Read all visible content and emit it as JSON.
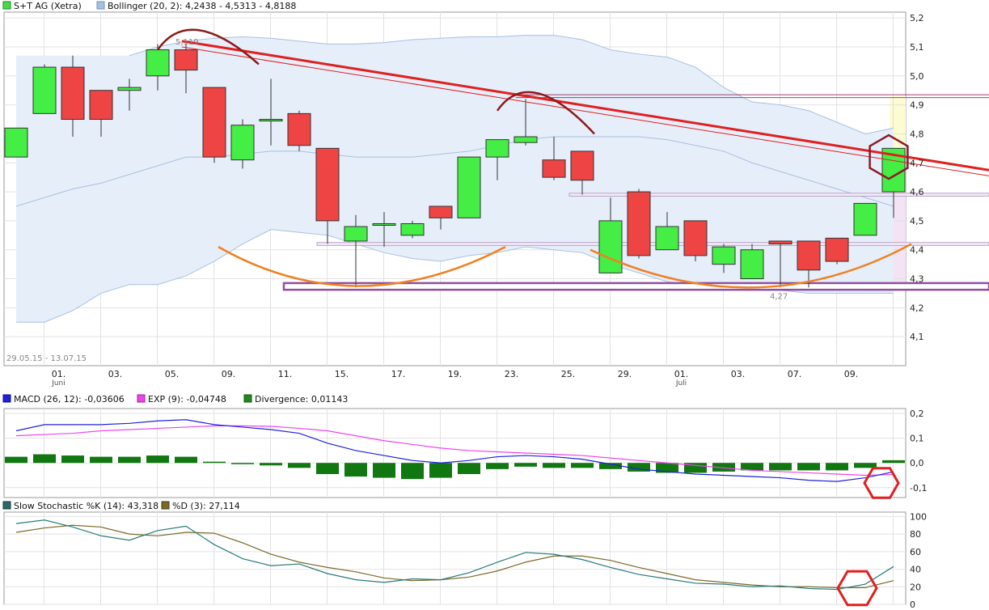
{
  "legends": {
    "main": [
      {
        "label": "S+T AG (Xetra)",
        "color": "#44dd44",
        "border": "#228822"
      },
      {
        "label": "Bollinger (20, 2): 4,2438 - 4,5313 - 4,8188",
        "color": "#a8c0e0",
        "border": "#7090c0"
      }
    ],
    "macd": [
      {
        "label": "MACD (26, 12): -0,03606",
        "color": "#2020dd",
        "border": "#101080"
      },
      {
        "label": "EXP (9): -0,04748",
        "color": "#ee44ee",
        "border": "#992299"
      },
      {
        "label": "Divergence: 0,01143",
        "color": "#228822",
        "border": "#115511"
      }
    ],
    "stoch": [
      {
        "label": "Slow Stochastic %K (14): 43,318",
        "color": "#2a6a6a",
        "border": "#143a3a"
      },
      {
        "label": "%D (3): 27,114",
        "color": "#7a6a2a",
        "border": "#4a3a10"
      }
    ]
  },
  "date_range_label": "29.05.15 - 13.07.15",
  "annotations": {
    "high": "5,119",
    "low": "4,27"
  },
  "colors": {
    "up": "#44ee44",
    "down": "#ee4444",
    "band": "#e6eefa",
    "band_line": "#a8c0e0",
    "trend": "#e02020",
    "resistance": "#a04070",
    "support": "#9050a0",
    "arc_top": "#8b1a1a",
    "arc_bottom": "#f08020",
    "marker": "#8b1a2a",
    "marker_red": "#e02020",
    "macd": "#2020dd",
    "exp": "#ee44ee",
    "divergence": "#117711",
    "stoch_k": "#2a7a7a",
    "stoch_d": "#7a6a2a",
    "zone_yellow": "#fdfbd2",
    "zone_pink": "#f3e3f5"
  },
  "chart_data": [
    {
      "type": "candlestick",
      "title": "S+T AG (Xetra)",
      "ylim": [
        4.0,
        5.22
      ],
      "yticks": [
        "5,2",
        "5,1",
        "5,0",
        "4,9",
        "4,8",
        "4,7",
        "4,6",
        "4,5",
        "4,4",
        "4,3",
        "4,2",
        "4,1"
      ],
      "ytick_values": [
        5.2,
        5.1,
        5.0,
        4.9,
        4.8,
        4.7,
        4.6,
        4.5,
        4.4,
        4.3,
        4.2,
        4.1
      ],
      "xticks": [
        {
          "label": "01.",
          "i": 1,
          "sub": "Juni"
        },
        {
          "label": "03.",
          "i": 3
        },
        {
          "label": "05.",
          "i": 5
        },
        {
          "label": "09.",
          "i": 7
        },
        {
          "label": "11.",
          "i": 9
        },
        {
          "label": "15.",
          "i": 11
        },
        {
          "label": "17.",
          "i": 13
        },
        {
          "label": "19.",
          "i": 15
        },
        {
          "label": "23.",
          "i": 17
        },
        {
          "label": "25.",
          "i": 19
        },
        {
          "label": "29.",
          "i": 21
        },
        {
          "label": "01.",
          "i": 23,
          "sub": "Juli"
        },
        {
          "label": "03.",
          "i": 25
        },
        {
          "label": "07.",
          "i": 27
        },
        {
          "label": "09.",
          "i": 29
        }
      ],
      "candles": [
        {
          "o": 4.72,
          "h": 4.72,
          "l": 4.72,
          "c": 4.82
        },
        {
          "o": 4.87,
          "h": 5.04,
          "l": 4.87,
          "c": 5.03
        },
        {
          "o": 5.03,
          "h": 5.07,
          "l": 4.79,
          "c": 4.85
        },
        {
          "o": 4.95,
          "h": 4.95,
          "l": 4.79,
          "c": 4.85
        },
        {
          "o": 4.95,
          "h": 4.99,
          "l": 4.88,
          "c": 4.96
        },
        {
          "o": 5.0,
          "h": 5.11,
          "l": 4.95,
          "c": 5.09
        },
        {
          "o": 5.09,
          "h": 5.12,
          "l": 4.94,
          "c": 5.02
        },
        {
          "o": 4.96,
          "h": 4.96,
          "l": 4.7,
          "c": 4.72
        },
        {
          "o": 4.71,
          "h": 4.85,
          "l": 4.68,
          "c": 4.83
        },
        {
          "o": 4.85,
          "h": 4.99,
          "l": 4.76,
          "c": 4.85
        },
        {
          "o": 4.87,
          "h": 4.88,
          "l": 4.74,
          "c": 4.76
        },
        {
          "o": 4.75,
          "h": 4.75,
          "l": 4.42,
          "c": 4.5
        },
        {
          "o": 4.43,
          "h": 4.52,
          "l": 4.27,
          "c": 4.48
        },
        {
          "o": 4.49,
          "h": 4.53,
          "l": 4.41,
          "c": 4.49
        },
        {
          "o": 4.45,
          "h": 4.5,
          "l": 4.44,
          "c": 4.49
        },
        {
          "o": 4.55,
          "h": 4.55,
          "l": 4.47,
          "c": 4.51
        },
        {
          "o": 4.51,
          "h": 4.72,
          "l": 4.51,
          "c": 4.72
        },
        {
          "o": 4.72,
          "h": 4.78,
          "l": 4.64,
          "c": 4.78
        },
        {
          "o": 4.77,
          "h": 4.92,
          "l": 4.76,
          "c": 4.79
        },
        {
          "o": 4.71,
          "h": 4.79,
          "l": 4.64,
          "c": 4.65
        },
        {
          "o": 4.74,
          "h": 4.74,
          "l": 4.59,
          "c": 4.64
        },
        {
          "o": 4.32,
          "h": 4.58,
          "l": 4.32,
          "c": 4.5
        },
        {
          "o": 4.6,
          "h": 4.61,
          "l": 4.37,
          "c": 4.38
        },
        {
          "o": 4.4,
          "h": 4.53,
          "l": 4.4,
          "c": 4.48
        },
        {
          "o": 4.5,
          "h": 4.5,
          "l": 4.36,
          "c": 4.38
        },
        {
          "o": 4.35,
          "h": 4.42,
          "l": 4.32,
          "c": 4.41
        },
        {
          "o": 4.3,
          "h": 4.42,
          "l": 4.3,
          "c": 4.4
        },
        {
          "o": 4.43,
          "h": 4.43,
          "l": 4.27,
          "c": 4.42
        },
        {
          "o": 4.43,
          "h": 4.43,
          "l": 4.27,
          "c": 4.33
        },
        {
          "o": 4.44,
          "h": 4.44,
          "l": 4.35,
          "c": 4.36
        },
        {
          "o": 4.45,
          "h": 4.56,
          "l": 4.45,
          "c": 4.56
        },
        {
          "o": 4.6,
          "h": 4.75,
          "l": 4.51,
          "c": 4.75
        }
      ],
      "bollinger_upper": [
        null,
        null,
        null,
        null,
        5.07,
        5.1,
        5.12,
        5.13,
        5.135,
        5.13,
        5.12,
        5.11,
        5.11,
        5.115,
        5.125,
        5.13,
        5.135,
        5.135,
        5.14,
        5.14,
        5.125,
        5.09,
        5.075,
        5.065,
        5.03,
        4.96,
        4.91,
        4.9,
        4.88,
        4.84,
        4.8,
        4.82
      ],
      "bollinger_mid": [
        4.55,
        4.58,
        4.61,
        4.63,
        4.66,
        4.69,
        4.72,
        4.72,
        4.73,
        4.74,
        4.74,
        4.73,
        4.72,
        4.72,
        4.72,
        4.73,
        4.74,
        4.76,
        4.78,
        4.79,
        4.79,
        4.79,
        4.79,
        4.78,
        4.76,
        4.74,
        4.7,
        4.67,
        4.64,
        4.61,
        4.58,
        4.55
      ],
      "bollinger_lower": [
        4.15,
        4.15,
        4.19,
        4.25,
        4.28,
        4.28,
        4.31,
        4.36,
        4.42,
        4.47,
        4.46,
        4.45,
        4.42,
        4.39,
        4.37,
        4.36,
        4.38,
        4.39,
        4.41,
        4.4,
        4.39,
        4.35,
        4.32,
        4.29,
        4.27,
        4.26,
        4.26,
        4.26,
        4.25,
        4.25,
        4.25,
        4.25
      ]
    },
    {
      "type": "line",
      "title": "MACD (26, 12)",
      "ylim": [
        -0.14,
        0.22
      ],
      "yticks": [
        "0,2",
        "0,1",
        "0,0",
        "-0,1"
      ],
      "ytick_values": [
        0.2,
        0.1,
        0.0,
        -0.1
      ],
      "series": [
        {
          "name": "MACD (26, 12)",
          "values": [
            0.13,
            0.155,
            0.155,
            0.155,
            0.16,
            0.17,
            0.175,
            0.155,
            0.145,
            0.135,
            0.12,
            0.08,
            0.05,
            0.03,
            0.01,
            0.0,
            0.01,
            0.025,
            0.03,
            0.025,
            0.015,
            -0.005,
            -0.025,
            -0.035,
            -0.045,
            -0.05,
            -0.055,
            -0.06,
            -0.07,
            -0.075,
            -0.06,
            -0.036
          ]
        },
        {
          "name": "EXP (9)",
          "values": [
            0.11,
            0.115,
            0.12,
            0.13,
            0.135,
            0.14,
            0.145,
            0.15,
            0.15,
            0.148,
            0.14,
            0.13,
            0.11,
            0.09,
            0.075,
            0.06,
            0.05,
            0.045,
            0.04,
            0.035,
            0.03,
            0.02,
            0.01,
            0.0,
            -0.01,
            -0.02,
            -0.03,
            -0.035,
            -0.04,
            -0.045,
            -0.05,
            -0.047
          ]
        }
      ],
      "divergence": [
        0.025,
        0.035,
        0.03,
        0.025,
        0.025,
        0.03,
        0.025,
        0.005,
        -0.005,
        -0.01,
        -0.02,
        -0.045,
        -0.055,
        -0.06,
        -0.065,
        -0.06,
        -0.045,
        -0.025,
        -0.015,
        -0.02,
        -0.02,
        -0.025,
        -0.035,
        -0.04,
        -0.04,
        -0.035,
        -0.03,
        -0.03,
        -0.03,
        -0.03,
        -0.02,
        0.011
      ]
    },
    {
      "type": "line",
      "title": "Slow Stochastic",
      "ylim": [
        0,
        105
      ],
      "yticks": [
        "100",
        "80",
        "60",
        "40",
        "20",
        "0"
      ],
      "ytick_values": [
        100,
        80,
        60,
        40,
        20,
        0
      ],
      "series": [
        {
          "name": "Slow Stochastic %K (14)",
          "values": [
            92,
            96,
            88,
            78,
            73,
            84,
            89,
            68,
            52,
            44,
            46,
            35,
            28,
            25,
            29,
            28,
            36,
            48,
            59,
            57,
            51,
            42,
            34,
            29,
            24,
            23,
            20,
            21,
            18,
            17,
            23,
            43
          ]
        },
        {
          "name": "%D (3)",
          "values": [
            82,
            87,
            90,
            88,
            80,
            78,
            82,
            81,
            70,
            57,
            48,
            42,
            37,
            30,
            27,
            28,
            31,
            38,
            48,
            55,
            55,
            50,
            42,
            35,
            28,
            25,
            22,
            20,
            20,
            19,
            19,
            27
          ]
        }
      ]
    }
  ]
}
